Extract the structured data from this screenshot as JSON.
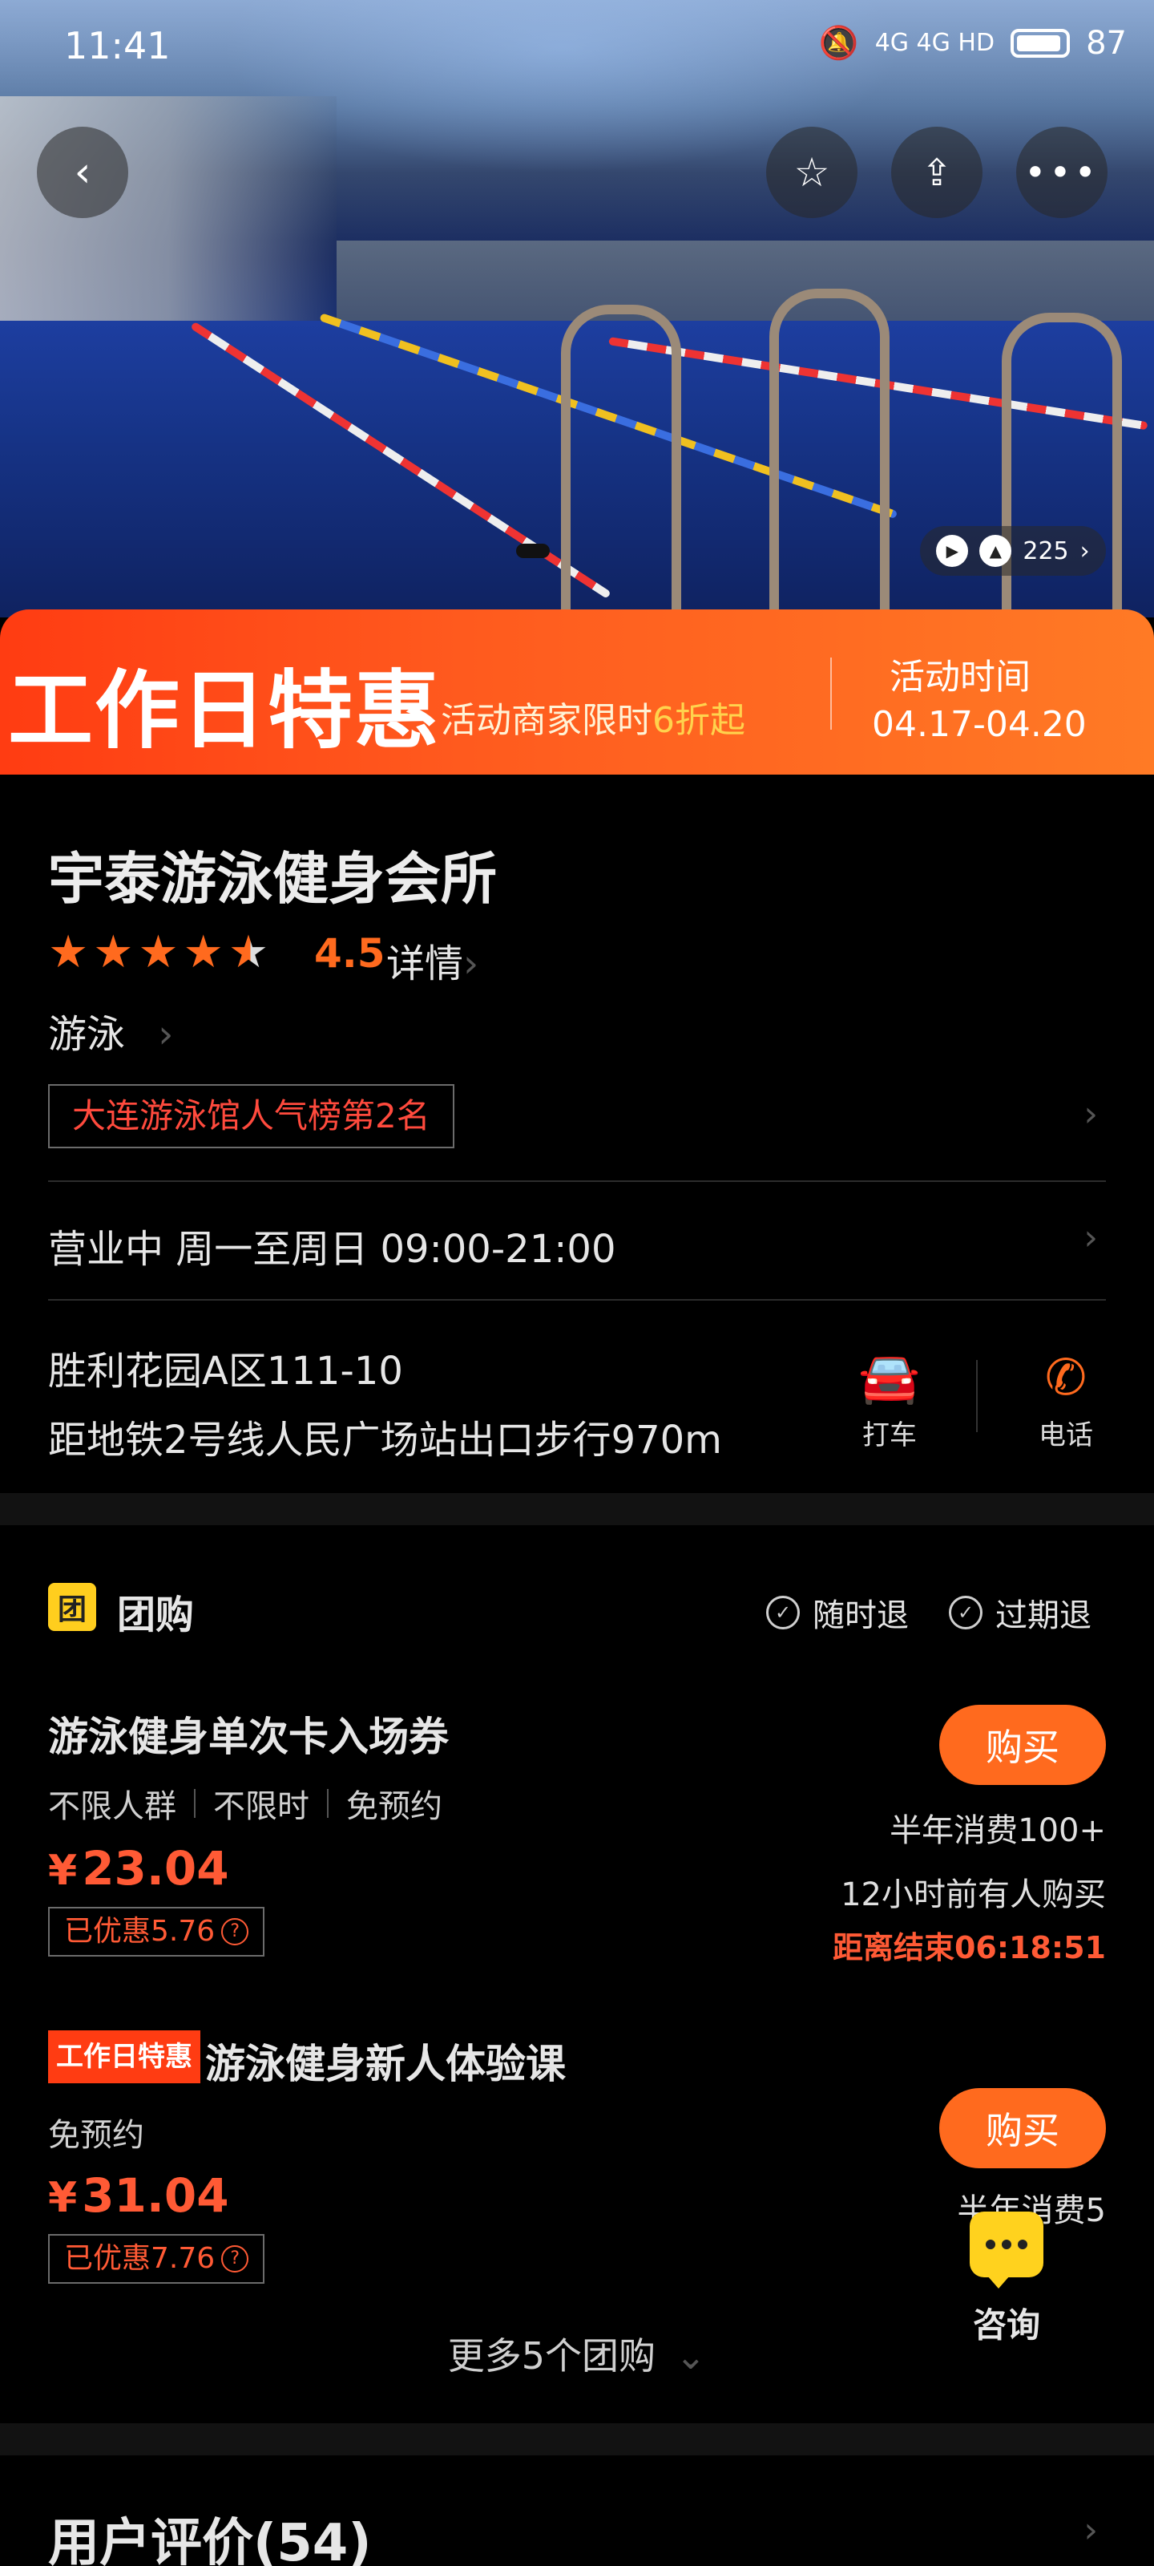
{
  "status_bar": {
    "time": "11:41",
    "network": "4G 4G HD",
    "battery": "87"
  },
  "hero": {
    "photo_count": "225"
  },
  "promo": {
    "title": "工作日特惠",
    "subtitle_prefix": "活动商家限时",
    "subtitle_highlight": "6折起",
    "time_label": "活动时间",
    "time_range": "04.17-04.20"
  },
  "shop": {
    "name": "宇泰游泳健身会所",
    "rating": "4.5",
    "rating_stars": 4.5,
    "detail_label": "详情",
    "category": "游泳",
    "rank_badge": "大连游泳馆人气榜第2名",
    "hours": "营业中  周一至周日 09:00-21:00",
    "address": "胜利花园A区111-10",
    "distance": "距地铁2号线人民广场站出口步行970m",
    "actions": [
      {
        "label": "打车",
        "icon": "car-icon",
        "color": "#1e88e5"
      },
      {
        "label": "电话",
        "icon": "phone-icon",
        "color": "#ff6a1e"
      }
    ]
  },
  "group_buy": {
    "icon_text": "团",
    "title": "团购",
    "policies": [
      "随时退",
      "过期退"
    ],
    "deals": [
      {
        "title": "游泳健身单次卡入场券",
        "tags": [
          "不限人群",
          "不限时",
          "免预约"
        ],
        "currency": "¥",
        "price": "23.04",
        "saved": "已优惠5.76",
        "buy_label": "购买",
        "sales": "半年消费100+",
        "recent": "12小时前有人购买",
        "countdown": "距离结束06:18:51"
      },
      {
        "badge": "工作日特惠",
        "title": "游泳健身新人体验课",
        "tags": [
          "免预约"
        ],
        "currency": "¥",
        "price": "31.04",
        "saved": "已优惠7.76",
        "buy_label": "购买",
        "sales": "半年消费5"
      }
    ],
    "more_label": "更多5个团购"
  },
  "consult": {
    "label": "咨询"
  },
  "reviews": {
    "title": "用户评价(54)"
  },
  "colors": {
    "accent": "#ff6a1e",
    "price": "#ff5a35",
    "promo": "#ff3c12",
    "yellow": "#ffce1e"
  }
}
